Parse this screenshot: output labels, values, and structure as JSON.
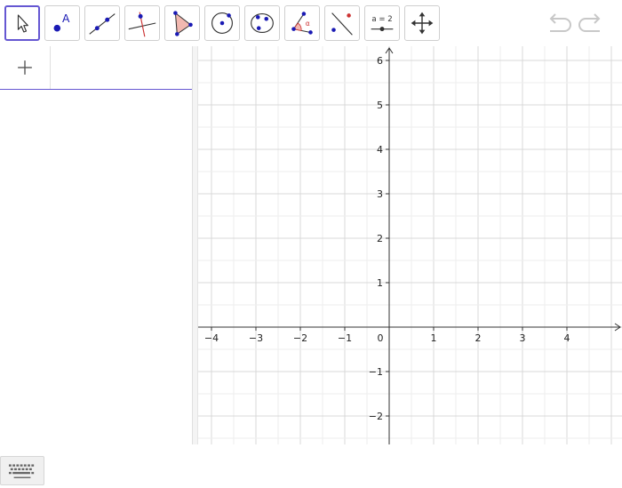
{
  "toolbar": {
    "tools": [
      {
        "name": "move-tool",
        "active": true
      },
      {
        "name": "point-tool",
        "label": "A"
      },
      {
        "name": "line-tool"
      },
      {
        "name": "perpendicular-line-tool"
      },
      {
        "name": "polygon-tool"
      },
      {
        "name": "circle-center-point-tool"
      },
      {
        "name": "circle-three-points-tool"
      },
      {
        "name": "angle-tool",
        "label": "α"
      },
      {
        "name": "reflect-about-line-tool"
      },
      {
        "name": "slider-tool",
        "label": "a = 2"
      },
      {
        "name": "move-graphics-view-tool"
      }
    ],
    "undo_icon": "undo-icon",
    "redo_icon": "redo-icon"
  },
  "algebra": {
    "add_icon": "plus-icon",
    "keyboard_icon": "keyboard-icon"
  },
  "graphics": {
    "x_ticks": [
      "−4",
      "−3",
      "−2",
      "−1",
      "0",
      "1",
      "2",
      "3",
      "4"
    ],
    "y_ticks": [
      "6",
      "5",
      "4",
      "3",
      "2",
      "1",
      "−1",
      "−2"
    ],
    "colors": {
      "axis": "#333333",
      "grid": "#d8d8d8",
      "accent": "#6557d2",
      "point": "#1a1ab4",
      "polygon_fill": "#f2b8b0",
      "red_line": "#cc3333"
    }
  }
}
